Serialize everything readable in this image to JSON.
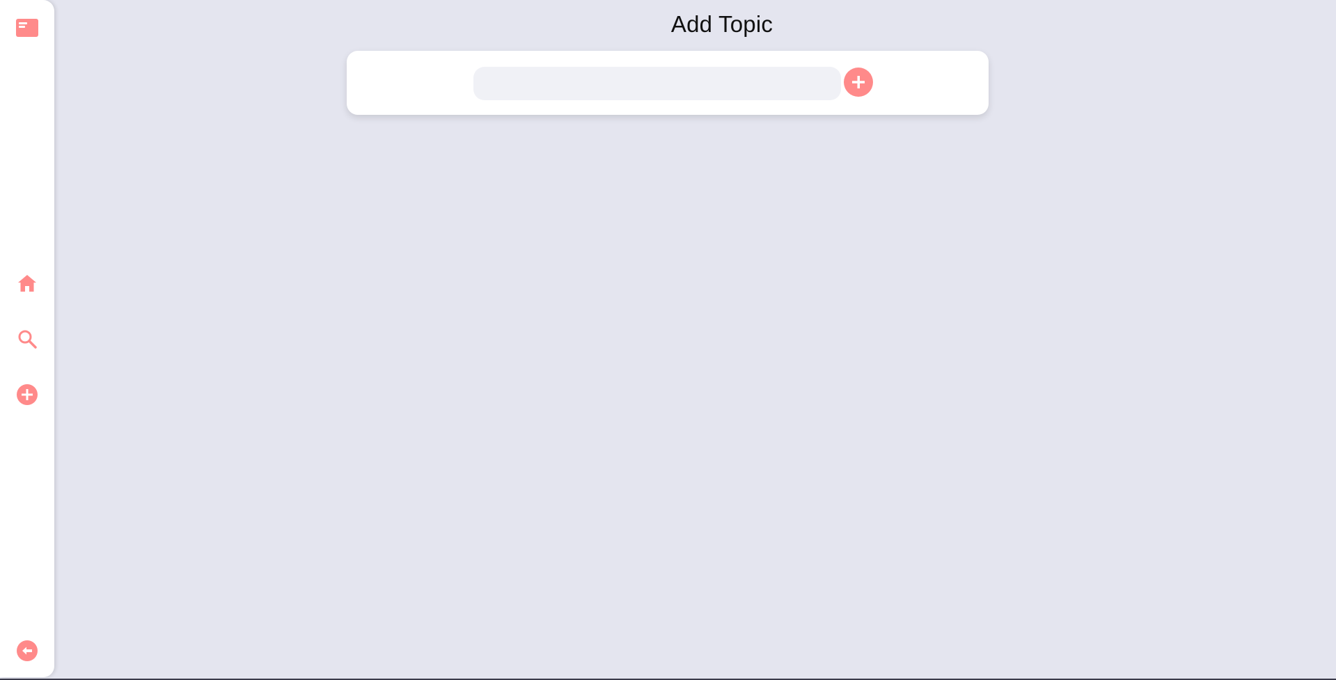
{
  "sidebar": {
    "logo_icon": "card-list-icon",
    "items": [
      {
        "name": "home",
        "icon": "home-icon"
      },
      {
        "name": "search",
        "icon": "search-icon"
      },
      {
        "name": "add",
        "icon": "plus-circle-icon"
      }
    ],
    "back_icon": "arrow-left-circle-icon"
  },
  "main": {
    "title": "Add Topic",
    "topic_input": {
      "value": "",
      "placeholder": ""
    },
    "submit_icon": "plus-circle-icon"
  },
  "colors": {
    "accent": "#ff8a8a",
    "background": "#e4e5ef",
    "panel": "#ffffff",
    "input_bg": "#f0f1f6"
  }
}
